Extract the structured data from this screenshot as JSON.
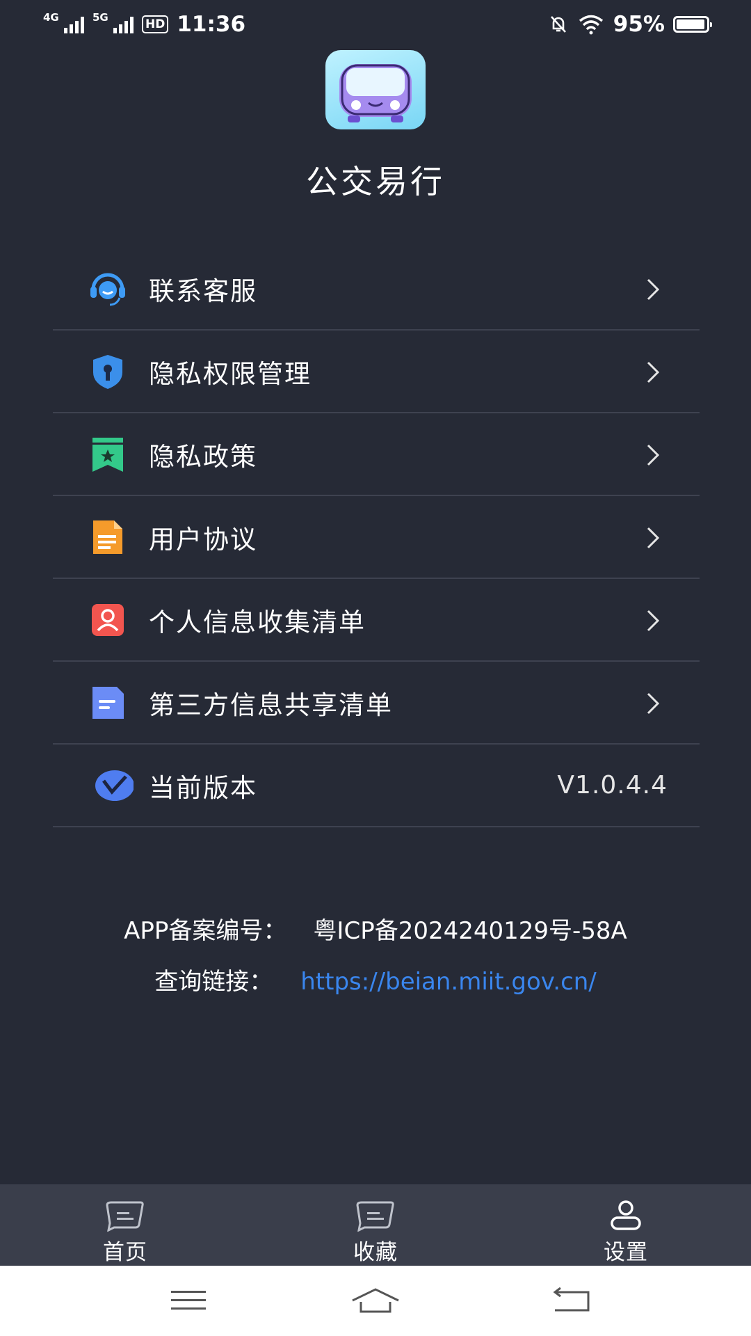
{
  "status_bar": {
    "network1": "4G",
    "network2": "5G",
    "hd": "HD",
    "time": "11:36",
    "battery_percent": "95%",
    "battery_level": 0.95
  },
  "app": {
    "title": "公交易行",
    "logo_icon": "bus-icon"
  },
  "menu": [
    {
      "label": "联系客服",
      "icon": "customer-service-icon",
      "color": "#3e9bf5"
    },
    {
      "label": "隐私权限管理",
      "icon": "shield-key-icon",
      "color": "#3b8fea"
    },
    {
      "label": "隐私政策",
      "icon": "bookmark-star-icon",
      "color": "#33c98a"
    },
    {
      "label": "用户协议",
      "icon": "document-icon",
      "color": "#f59b2b"
    },
    {
      "label": "个人信息收集清单",
      "icon": "person-card-icon",
      "color": "#f2554f"
    },
    {
      "label": "第三方信息共享清单",
      "icon": "note-icon",
      "color": "#6b8cf6"
    },
    {
      "label": "当前版本",
      "icon": "version-icon",
      "color": "#4f7df0",
      "value": "V1.0.4.4"
    }
  ],
  "icp": {
    "label": "APP备案编号：",
    "code": "粤ICP备2024240129号-58A",
    "query_label": "查询链接：",
    "query_link": "https://beian.miit.gov.cn/"
  },
  "tabs": [
    {
      "label": "首页",
      "icon": "home-icon"
    },
    {
      "label": "收藏",
      "icon": "favorites-icon"
    },
    {
      "label": "设置",
      "icon": "user-icon",
      "active": true
    }
  ]
}
